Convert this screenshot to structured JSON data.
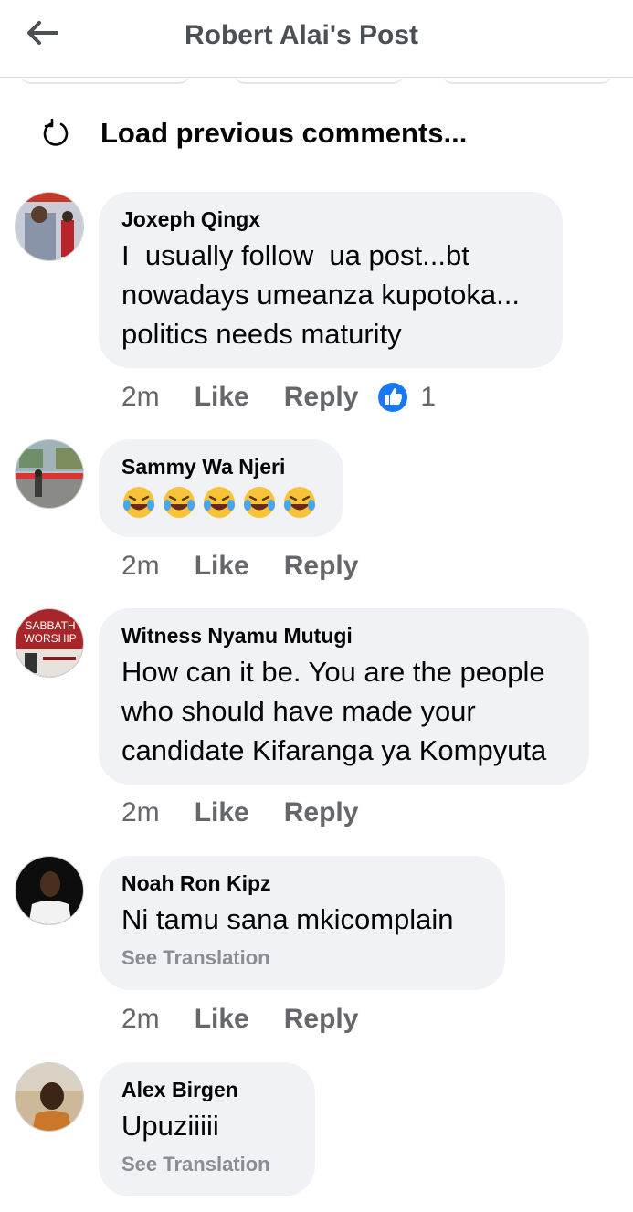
{
  "header": {
    "title": "Robert Alai's Post"
  },
  "load_previous": {
    "label": "Load previous comments..."
  },
  "comments": [
    {
      "author": "Joxeph Qingx",
      "text": "I  usually follow  ua post...bt nowadays umeanza kupotoka... politics needs maturity",
      "time": "2m",
      "like": "Like",
      "reply": "Reply",
      "reactions": "1"
    },
    {
      "author": "Sammy Wa Njeri",
      "emoji": [
        "😂",
        "😂",
        "😂",
        "😂",
        "😂"
      ],
      "time": "2m",
      "like": "Like",
      "reply": "Reply"
    },
    {
      "author": "Witness Nyamu Mutugi",
      "text": "How can it be. You are the people who should have made your candidate Kifaranga ya Kompyuta",
      "time": "2m",
      "like": "Like",
      "reply": "Reply",
      "avatar_text": [
        "SABBATH",
        "WORSHIP"
      ]
    },
    {
      "author": "Noah Ron Kipz",
      "text": "Ni tamu sana mkicomplain",
      "see_translation": "See Translation",
      "time": "2m",
      "like": "Like",
      "reply": "Reply"
    },
    {
      "author": "Alex Birgen",
      "text": "Upuziiiii",
      "see_translation": "See Translation"
    }
  ],
  "colors": {
    "bubble": "#f0f2f5",
    "secondary_text": "#65676b",
    "like_blue": "#1877f2"
  },
  "icons": {
    "back": "back-arrow-icon",
    "refresh": "refresh-icon",
    "like_reaction": "like-reaction-icon"
  }
}
